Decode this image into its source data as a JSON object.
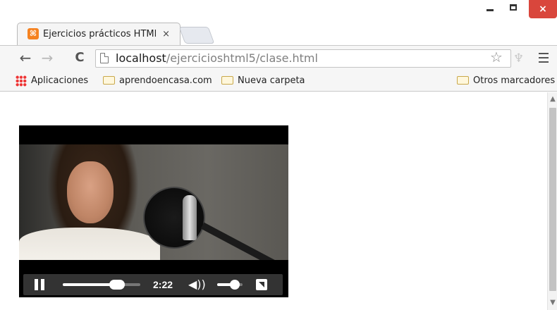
{
  "tab": {
    "title": "Ejercicios prácticos HTML",
    "close_glyph": "×",
    "favicon_glyph": "⌘"
  },
  "window_controls": {
    "close_glyph": "×"
  },
  "toolbar": {
    "back_glyph": "←",
    "forward_glyph": "→",
    "reload_glyph": "C",
    "url_host": "localhost",
    "url_path": "/ejercicioshtml5/clase.html",
    "star_glyph": "☆",
    "extension_glyph": "♆"
  },
  "bookmarks": [
    {
      "label": "Aplicaciones",
      "icon": "apps-grid-icon"
    },
    {
      "label": "aprendoencasa.com",
      "icon": "folder-icon"
    },
    {
      "label": "Nueva carpeta",
      "icon": "folder-icon"
    },
    {
      "label": "Otros marcadores",
      "icon": "folder-icon"
    }
  ],
  "video": {
    "current_time": "2:22",
    "progress_fraction": 0.7,
    "volume_fraction": 0.7,
    "volume_glyph": "◀))"
  },
  "scrollbar": {
    "up_glyph": "▲",
    "down_glyph": "▼"
  },
  "colors": {
    "close_button": "#d9463c",
    "tab_favicon": "#f58220",
    "control_bar": "#333333"
  }
}
